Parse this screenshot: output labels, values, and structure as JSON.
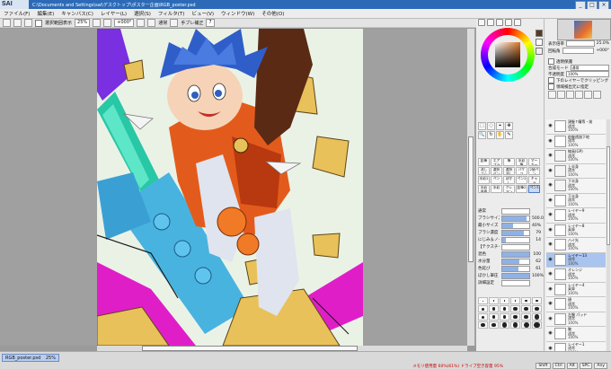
{
  "window": {
    "logo": "SAI",
    "title_path": "C:\\Documents and Settings\\sai\\デスクトップ\\ポスター企画\\RGB_poster.psd",
    "buttons": [
      "_",
      "□",
      "×"
    ]
  },
  "menu": [
    "ファイル(F)",
    "編集(E)",
    "キャンバス(C)",
    "レイヤー(L)",
    "選択(S)",
    "フィルタ(T)",
    "ビュー(V)",
    "ウィンドウ(W)",
    "その他(O)"
  ],
  "toolbar": {
    "selection_label": "選択範囲表示",
    "zoom": "25%",
    "rotate": "+000°",
    "normal_label": "通常",
    "stabilizer_label": "手ブレ補正",
    "stabilizer_value": "7"
  },
  "status": {
    "doc_tab": "RGB_poster.psd",
    "doc_zoom": "25%",
    "memory": "メモリ使用量 60%(61%) ドライブ空き容量 95%",
    "icons": [
      "Shift",
      "Ctrl",
      "Alt",
      "SPC",
      "Any"
    ]
  },
  "navigator": {
    "zoom_label": "表示倍率",
    "zoom_value": "25.0%",
    "angle_label": "回転角",
    "angle_value": "+000°"
  },
  "layer_props": {
    "protect_label": "透明保護",
    "mode_label": "合成モード",
    "mode_value": "通常",
    "opacity_label": "不透明度",
    "opacity_value": "100%",
    "clip_label": "下のレイヤーでクリッピング",
    "ref_label": "領域検出元に指定"
  },
  "tools": {
    "rows": [
      [
        "⬚",
        "◌",
        "⌖",
        "✥"
      ],
      [
        "🔍",
        "↻",
        "✋",
        "✎"
      ]
    ],
    "brushes": [
      "鉛筆",
      "エアブラシ",
      "筆",
      "水彩筆",
      "マーカー",
      "消しゴム",
      "選択ペン",
      "選択消し",
      "バケツ",
      "2値ペン",
      "水彩2",
      "ペン",
      "ぼかし",
      "ペン2",
      "キャラ",
      "水彩境界",
      "水彩",
      "クレヨン",
      "鉛筆2",
      "ペン3"
    ],
    "selected_brush_index": 19
  },
  "brush_params": [
    {
      "label": "通常",
      "value": "",
      "fill": 0
    },
    {
      "label": "ブラシサイズ",
      "value": "500.0",
      "fill": 0.9
    },
    {
      "label": "最小サイズ",
      "value": "40%",
      "fill": 0.4
    },
    {
      "label": "ブラシ濃度",
      "value": "79",
      "fill": 0.79
    },
    {
      "label": "にじみ＆ノイズ",
      "value": "14",
      "fill": 0.14
    },
    {
      "label": "【テクスチャなし】",
      "value": "",
      "fill": 0
    },
    {
      "label": "混色",
      "value": "100",
      "fill": 1.0
    },
    {
      "label": "水分量",
      "value": "62",
      "fill": 0.62
    },
    {
      "label": "色延び",
      "value": "61",
      "fill": 0.61
    },
    {
      "label": "ぼかし筆圧",
      "value": "100%",
      "fill": 1.0
    },
    {
      "label": "詳細設定",
      "value": "",
      "fill": 0
    }
  ],
  "dot_sizes": [
    1,
    1.5,
    2,
    2.5,
    3,
    3.5,
    4,
    4.5,
    5,
    5.5,
    6,
    6.5,
    4,
    4.5,
    5,
    5.5,
    6,
    7,
    6,
    6.5,
    7,
    7.5,
    8,
    8.5
  ],
  "layers": [
    {
      "name": "頭髪↑瞳等・前",
      "mode": "通常",
      "opacity": "100%",
      "folder": false,
      "selected": false
    },
    {
      "name": "前髪透過下地",
      "mode": "通常",
      "opacity": "100%",
      "folder": false,
      "selected": false
    },
    {
      "name": "線画(GP)",
      "mode": "通常",
      "opacity": "100%",
      "folder": true,
      "selected": false
    },
    {
      "name": "上半身",
      "mode": "通常",
      "opacity": "100%",
      "folder": true,
      "selected": false
    },
    {
      "name": "下半身",
      "mode": "通常",
      "opacity": "100%",
      "folder": true,
      "selected": false
    },
    {
      "name": "下半身",
      "mode": "通常",
      "opacity": "100%",
      "folder": false,
      "selected": false
    },
    {
      "name": "レイヤー9",
      "mode": "通常",
      "opacity": "100%",
      "folder": false,
      "selected": false
    },
    {
      "name": "レイヤー8",
      "mode": "乗算",
      "opacity": "100%",
      "folder": false,
      "selected": false
    },
    {
      "name": "ハイ光",
      "mode": "通常",
      "opacity": "100%",
      "folder": false,
      "selected": false
    },
    {
      "name": "レイヤー13",
      "mode": "通常",
      "opacity": "100%",
      "folder": false,
      "selected": true
    },
    {
      "name": "オレンジ",
      "mode": "通常",
      "opacity": "100%",
      "folder": false,
      "selected": false
    },
    {
      "name": "レイヤー4",
      "mode": "乗算",
      "opacity": "100%",
      "folder": false,
      "selected": false
    },
    {
      "name": "顔",
      "mode": "通常",
      "opacity": "100%",
      "folder": false,
      "selected": false
    },
    {
      "name": "左腕 パッド",
      "mode": "通常",
      "opacity": "100%",
      "folder": false,
      "selected": false
    },
    {
      "name": "腕",
      "mode": "通常",
      "opacity": "100%",
      "folder": false,
      "selected": false
    },
    {
      "name": "レイヤー1",
      "mode": "通常",
      "opacity": "100%",
      "folder": false,
      "selected": false
    }
  ],
  "colors": {
    "titlebar": "#2c6ab8",
    "selection": "#a9c4ef",
    "hair": "#2f5ec9",
    "jacket": "#e35b1c",
    "teal": "#28c7a6",
    "cyan": "#49b3e0",
    "magenta": "#e01ec8",
    "rock": "#e9c15a"
  },
  "icons": {
    "eye": "eye-icon",
    "folder": "folder-icon"
  }
}
